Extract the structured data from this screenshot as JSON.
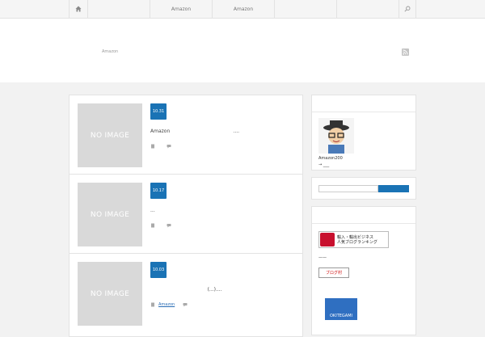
{
  "nav": {
    "items": [
      {
        "label": ""
      },
      {
        "label": ""
      },
      {
        "label": "Amazon"
      },
      {
        "label": "Amazon"
      },
      {
        "label": ""
      },
      {
        "label": ""
      }
    ]
  },
  "header": {
    "description": "Amazon"
  },
  "posts": [
    {
      "thumb": "NO IMAGE",
      "date": "10.31",
      "excerpt": "Amazon                                         ....",
      "category": ""
    },
    {
      "thumb": "NO IMAGE",
      "date": "10.17",
      "excerpt": "...",
      "category": ""
    },
    {
      "thumb": "NO IMAGE",
      "date": "10.03",
      "excerpt": "                                     (...)....",
      "category": "Amazon"
    }
  ],
  "sidebar": {
    "profile": {
      "name": "Amazon200",
      "more": "→ ___"
    },
    "banners": {
      "banner1_line1": "輸入・輸出ビジネス",
      "banner1_line2": "人気ブログランキング",
      "dash": "——",
      "banner2": "ブログ村",
      "banner3": "OKITEGAMI"
    }
  },
  "colors": {
    "accent": "#1a73b5",
    "thumb": "#d9d9d9",
    "background": "#f2f2f2"
  }
}
